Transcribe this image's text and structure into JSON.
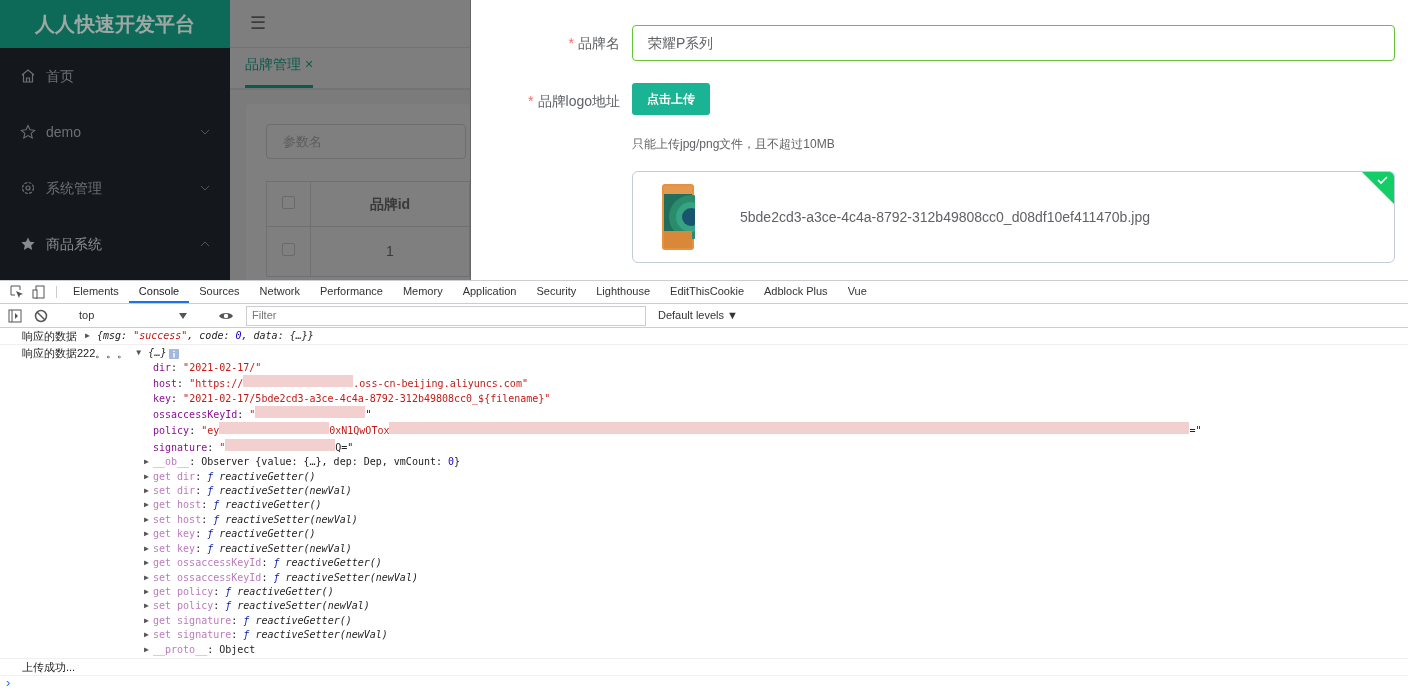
{
  "app": {
    "title": "人人快速开发平台",
    "menu_toggle": "☰",
    "menu": [
      {
        "label": "首页"
      },
      {
        "label": "demo",
        "expanded": false
      },
      {
        "label": "系统管理",
        "expanded": false
      },
      {
        "label": "商品系统",
        "expanded": true
      }
    ],
    "tabs": [
      {
        "label": "品牌管理",
        "close": "×",
        "selected": true
      }
    ],
    "search": {
      "placeholder": "参数名"
    },
    "table": {
      "columns": [
        "品牌id"
      ],
      "rows": [
        {
          "checked": false,
          "cells": [
            "1"
          ]
        }
      ],
      "header_checked": false
    }
  },
  "dialog": {
    "fields": [
      {
        "kind": "input",
        "required_mark": "*",
        "label": "品牌名",
        "value": "荣耀P系列",
        "valid": true
      },
      {
        "kind": "upload",
        "required_mark": "*",
        "label": "品牌logo地址",
        "button": "点击上传",
        "tip": "只能上传jpg/png文件，且不超过10MB",
        "files": [
          {
            "name": "5bde2cd3-a3ce-4c4a-8792-312b49808cc0_d08df10ef411470b.jpg",
            "uploaded": true
          }
        ]
      }
    ]
  },
  "devtools": {
    "tabs": [
      {
        "label": "Elements",
        "selected": false
      },
      {
        "label": "Console",
        "selected": true
      },
      {
        "label": "Sources",
        "selected": false
      },
      {
        "label": "Network",
        "selected": false
      },
      {
        "label": "Performance",
        "selected": false
      },
      {
        "label": "Memory",
        "selected": false
      },
      {
        "label": "Application",
        "selected": false
      },
      {
        "label": "Security",
        "selected": false
      },
      {
        "label": "Lighthouse",
        "selected": false
      },
      {
        "label": "EditThisCookie",
        "selected": false
      },
      {
        "label": "Adblock Plus",
        "selected": false
      },
      {
        "label": "Vue",
        "selected": false
      }
    ],
    "context": "top",
    "filter": {
      "placeholder": "Filter"
    },
    "levels": "Default levels ▼",
    "console": [
      {
        "label": "响应的数据",
        "toggle": "▶",
        "summary": [
          {
            "t": "{msg: ",
            "kind": "plain"
          },
          {
            "t": "\"success\"",
            "kind": "string"
          },
          {
            "t": ", code: ",
            "kind": "plain"
          },
          {
            "t": "0",
            "kind": "number"
          },
          {
            "t": ", data: {…}}",
            "kind": "plain"
          }
        ]
      },
      {
        "label": "响应的数据222。。。",
        "toggle": "▼",
        "summary": [
          {
            "t": "{…}",
            "kind": "plain"
          }
        ],
        "info": true,
        "children": [
          {
            "tokens": [
              {
                "t": "dir",
                "kind": "key"
              },
              {
                "t": ": ",
                "kind": "plain"
              },
              {
                "t": "\"2021-02-17/\"",
                "kind": "string"
              }
            ]
          },
          {
            "tokens": [
              {
                "t": "host",
                "kind": "key"
              },
              {
                "t": ": ",
                "kind": "plain"
              },
              {
                "t": "\"https://",
                "kind": "string"
              },
              {
                "kind": "redaction"
              },
              {
                "t": ".oss-cn-beijing.aliyuncs.com\"",
                "kind": "string"
              }
            ]
          },
          {
            "tokens": [
              {
                "t": "key",
                "kind": "key"
              },
              {
                "t": ": ",
                "kind": "plain"
              },
              {
                "t": "\"2021-02-17/5bde2cd3-a3ce-4c4a-8792-312b49808cc0_${filename}\"",
                "kind": "string"
              }
            ]
          },
          {
            "tokens": [
              {
                "t": "ossaccessKeyId",
                "kind": "key"
              },
              {
                "t": ": ",
                "kind": "plain"
              },
              {
                "t": "\"",
                "kind": "string"
              },
              {
                "kind": "redaction"
              },
              {
                "t": "\"",
                "kind": "plain"
              }
            ]
          },
          {
            "tokens": [
              {
                "t": "policy",
                "kind": "key"
              },
              {
                "t": ": ",
                "kind": "plain"
              },
              {
                "t": "\"ey",
                "kind": "string"
              },
              {
                "kind": "redaction"
              },
              {
                "t": "0xN1QwOTox",
                "kind": "string"
              },
              {
                "kind": "long-redaction"
              },
              {
                "t": "=\"",
                "kind": "plain"
              }
            ]
          },
          {
            "tokens": [
              {
                "t": "signature",
                "kind": "key"
              },
              {
                "t": ": ",
                "kind": "plain"
              },
              {
                "t": "\"",
                "kind": "string"
              },
              {
                "kind": "redaction"
              },
              {
                "t": "Q=\"",
                "kind": "plain"
              }
            ]
          },
          {
            "toggle": "▶",
            "tokens": [
              {
                "t": "__ob__",
                "kind": "accessor"
              },
              {
                "t": ": Observer {value: {…}, dep: Dep, vmCount: ",
                "kind": "plain"
              },
              {
                "t": "0",
                "kind": "number"
              },
              {
                "t": "}",
                "kind": "plain"
              }
            ]
          },
          {
            "toggle": "▶",
            "tokens": [
              {
                "t": "get dir",
                "kind": "accessor"
              },
              {
                "t": ": ",
                "kind": "plain"
              },
              {
                "t": "ƒ",
                "kind": "function"
              },
              {
                "t": " reactiveGetter()",
                "kind": "call"
              }
            ]
          },
          {
            "toggle": "▶",
            "tokens": [
              {
                "t": "set dir",
                "kind": "accessor"
              },
              {
                "t": ": ",
                "kind": "plain"
              },
              {
                "t": "ƒ",
                "kind": "function"
              },
              {
                "t": " reactiveSetter(newVal)",
                "kind": "call"
              }
            ]
          },
          {
            "toggle": "▶",
            "tokens": [
              {
                "t": "get host",
                "kind": "accessor"
              },
              {
                "t": ": ",
                "kind": "plain"
              },
              {
                "t": "ƒ",
                "kind": "function"
              },
              {
                "t": " reactiveGetter()",
                "kind": "call"
              }
            ]
          },
          {
            "toggle": "▶",
            "tokens": [
              {
                "t": "set host",
                "kind": "accessor"
              },
              {
                "t": ": ",
                "kind": "plain"
              },
              {
                "t": "ƒ",
                "kind": "function"
              },
              {
                "t": " reactiveSetter(newVal)",
                "kind": "call"
              }
            ]
          },
          {
            "toggle": "▶",
            "tokens": [
              {
                "t": "get key",
                "kind": "accessor"
              },
              {
                "t": ": ",
                "kind": "plain"
              },
              {
                "t": "ƒ",
                "kind": "function"
              },
              {
                "t": " reactiveGetter()",
                "kind": "call"
              }
            ]
          },
          {
            "toggle": "▶",
            "tokens": [
              {
                "t": "set key",
                "kind": "accessor"
              },
              {
                "t": ": ",
                "kind": "plain"
              },
              {
                "t": "ƒ",
                "kind": "function"
              },
              {
                "t": " reactiveSetter(newVal)",
                "kind": "call"
              }
            ]
          },
          {
            "toggle": "▶",
            "tokens": [
              {
                "t": "get ossaccessKeyId",
                "kind": "accessor"
              },
              {
                "t": ": ",
                "kind": "plain"
              },
              {
                "t": "ƒ",
                "kind": "function"
              },
              {
                "t": " reactiveGetter()",
                "kind": "call"
              }
            ]
          },
          {
            "toggle": "▶",
            "tokens": [
              {
                "t": "set ossaccessKeyId",
                "kind": "accessor"
              },
              {
                "t": ": ",
                "kind": "plain"
              },
              {
                "t": "ƒ",
                "kind": "function"
              },
              {
                "t": " reactiveSetter(newVal)",
                "kind": "call"
              }
            ]
          },
          {
            "toggle": "▶",
            "tokens": [
              {
                "t": "get policy",
                "kind": "accessor"
              },
              {
                "t": ": ",
                "kind": "plain"
              },
              {
                "t": "ƒ",
                "kind": "function"
              },
              {
                "t": " reactiveGetter()",
                "kind": "call"
              }
            ]
          },
          {
            "toggle": "▶",
            "tokens": [
              {
                "t": "set policy",
                "kind": "accessor"
              },
              {
                "t": ": ",
                "kind": "plain"
              },
              {
                "t": "ƒ",
                "kind": "function"
              },
              {
                "t": " reactiveSetter(newVal)",
                "kind": "call"
              }
            ]
          },
          {
            "toggle": "▶",
            "tokens": [
              {
                "t": "get signature",
                "kind": "accessor"
              },
              {
                "t": ": ",
                "kind": "plain"
              },
              {
                "t": "ƒ",
                "kind": "function"
              },
              {
                "t": " reactiveGetter()",
                "kind": "call"
              }
            ]
          },
          {
            "toggle": "▶",
            "tokens": [
              {
                "t": "set signature",
                "kind": "accessor"
              },
              {
                "t": ": ",
                "kind": "plain"
              },
              {
                "t": "ƒ",
                "kind": "function"
              },
              {
                "t": " reactiveSetter(newVal)",
                "kind": "call"
              }
            ]
          },
          {
            "toggle": "▶",
            "tokens": [
              {
                "t": "__proto__",
                "kind": "accessor"
              },
              {
                "t": ": Object",
                "kind": "plain"
              }
            ]
          }
        ]
      },
      {
        "label": "上传成功..."
      }
    ],
    "prompt": "›"
  }
}
